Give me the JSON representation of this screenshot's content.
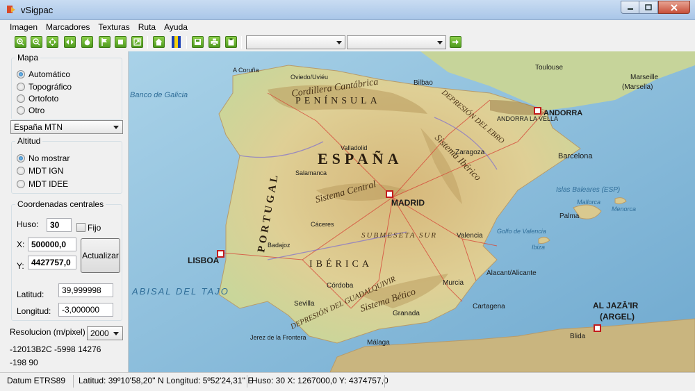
{
  "window": {
    "title": "vSigpac"
  },
  "menu": [
    "Imagen",
    "Marcadores",
    "Texturas",
    "Ruta",
    "Ayuda"
  ],
  "toolbar": {
    "buttons": [
      "zoom-in-icon",
      "zoom-out-icon",
      "pan-all-icon",
      "pan-horizontal-icon",
      "apple-icon",
      "flag-icon",
      "stop-icon",
      "fullscreen-icon",
      "home-icon",
      "flag-andalucia-icon",
      "save-icon",
      "print-icon",
      "clipboard-icon",
      "go-arrow-icon"
    ],
    "combo1": "",
    "combo2": ""
  },
  "panel": {
    "mapa": {
      "title": "Mapa",
      "options": [
        {
          "label": "Automático",
          "checked": true
        },
        {
          "label": "Topográfico",
          "checked": false
        },
        {
          "label": "Ortofoto",
          "checked": false
        },
        {
          "label": "Otro",
          "checked": false
        }
      ],
      "layer_select": "España MTN"
    },
    "altitud": {
      "title": "Altitud",
      "options": [
        {
          "label": "No mostrar",
          "checked": true
        },
        {
          "label": "MDT IGN",
          "checked": false
        },
        {
          "label": "MDT IDEE",
          "checked": false
        }
      ]
    },
    "coords": {
      "title": "Coordenadas centrales",
      "huso_label": "Huso:",
      "huso_value": "30",
      "fijo_label": "Fijo",
      "x_label": "X:",
      "x_value": "500000,0",
      "y_label": "Y:",
      "y_value": "4427757,0",
      "update_label": "Actualizar",
      "lat_label": "Latitud:",
      "lat_value": "39,999998",
      "lon_label": "Longitud:",
      "lon_value": "-3,000000"
    },
    "resolution": {
      "label": "Resolucion (m/pixel)",
      "value": "2000"
    },
    "info_line1": "-12013B2C -5998 14276",
    "info_line2": "-198 90"
  },
  "map": {
    "labels": {
      "country_es": "ESPAÑA",
      "country_pt": "PORTUGAL",
      "peninsula": "PENÍNSULA",
      "iberica": "IBÉRICA",
      "madrid": "MADRID",
      "lisboa": "LISBOA",
      "andorra": "ANDORRA",
      "andorra_vella": "ANDORRA LA VELLA",
      "algeria": "AL JAZĀ'IR",
      "algeria2": "(ARGEL)",
      "barcelona": "Barcelona",
      "valencia": "Valencia",
      "sevilla": "Sevilla",
      "malaga": "Málaga",
      "granada": "Granada",
      "cordoba": "Córdoba",
      "murcia": "Murcia",
      "cartagena": "Cartagena",
      "alacant": "Alacant/Alicante",
      "zaragoza": "Zaragoza",
      "bilbao": "Bilbao",
      "oviedo": "Oviedo/Uviéu",
      "coruna": "A Coruña",
      "toulouse": "Toulouse",
      "marseille1": "Marseille",
      "marseille2": "(Marsella)",
      "palma": "Palma",
      "valladolid": "Valladolid",
      "salamanca": "Salamanca",
      "caceres": "Cáceres",
      "badajoz": "Badajoz",
      "jerez": "Jerez de la Frontera",
      "blida": "Blida",
      "cordillera": "Cordillera Cantábrica",
      "sistema_central": "Sistema Central",
      "sistema_iberico": "Sistema Ibérico",
      "sistema_betico": "Sistema Bético",
      "depresion_ebro": "DEPRESIÓN DEL EBRO",
      "depresion_guadalquivir": "DEPRESIÓN DEL GUADALQUIVIR",
      "submeseta": "SUBMESETA SUR",
      "banco_galicia": "Banco de Galicia",
      "abisal_tajo": "ABISAL DEL TAJO",
      "islas_baleares": "Islas Baleares (ESP)",
      "mallorca": "Mallorca",
      "menorca": "Menorca",
      "ibiza": "Ibiza",
      "golfo_valencia": "Golfo de Valencia"
    }
  },
  "status": {
    "datum": "Datum ETRS89",
    "latlon": "Latitud: 39º10'58,20'' N Longitud: 5º52'24,31'' E",
    "utm": "Huso: 30 X: 1267000,0 Y: 4374757,0"
  },
  "colors": {
    "land": "#d9c98f",
    "mountain": "#b89a5c",
    "sea": "#8fbfdc",
    "toolbar_green": "#5fab2a"
  }
}
